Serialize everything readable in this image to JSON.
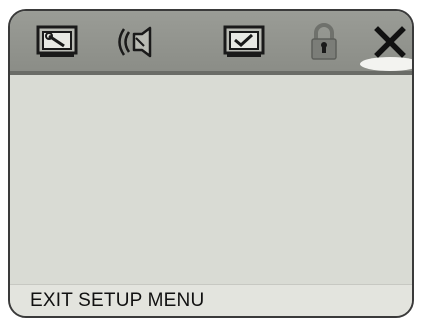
{
  "tabs": [
    {
      "icon": "setup-wrench-icon",
      "active": false
    },
    {
      "icon": "audio-speaker-icon",
      "active": false
    },
    {
      "icon": "preferences-check-icon",
      "active": false
    },
    {
      "icon": "parental-lock-icon",
      "active": false
    },
    {
      "icon": "exit-x-icon",
      "active": true
    }
  ],
  "status": {
    "text": "EXIT SETUP MENU"
  },
  "colors": {
    "tabbar": "#8f918b",
    "panel": "#d9dbd4",
    "statusbar": "#e3e4de",
    "icon_dark": "#1a1a1a"
  }
}
